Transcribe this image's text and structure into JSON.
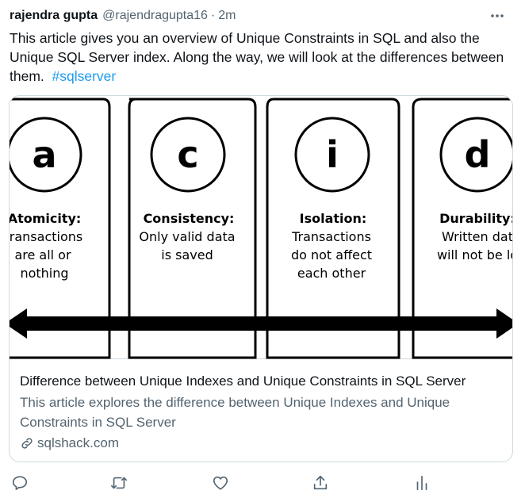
{
  "tweet": {
    "author_name": "rajendra gupta",
    "author_handle": "@rajendragupta16",
    "separator": "·",
    "timestamp": "2m",
    "text": "This article gives you an overview of Unique Constraints in SQL and also the Unique SQL Server index. Along the way, we will look at the differences between them.",
    "hashtag": "#sqlserver"
  },
  "card": {
    "image": {
      "letters": [
        "a",
        "c",
        "i",
        "d"
      ],
      "headings": [
        "Atomicity:",
        "Consistency:",
        "Isolation:",
        "Durability:"
      ],
      "lines": [
        [
          "ransactions",
          "are all or",
          "nothing"
        ],
        [
          "Only valid data",
          "is saved"
        ],
        [
          "Transactions",
          "do not affect",
          "each other"
        ],
        [
          "Written dat",
          "will not be lo"
        ]
      ]
    },
    "title": "Difference between Unique Indexes and Unique Constraints in SQL Server",
    "description": "This article explores the difference between Unique Indexes and Unique Constraints in SQL Server",
    "domain": "sqlshack.com"
  },
  "actions": {
    "icons": [
      "reply-icon",
      "retweet-icon",
      "like-icon",
      "share-icon",
      "analytics-icon"
    ]
  },
  "colors": {
    "link": "#1d9bf0",
    "secondary_text": "#536471",
    "border": "#cfd9de"
  }
}
